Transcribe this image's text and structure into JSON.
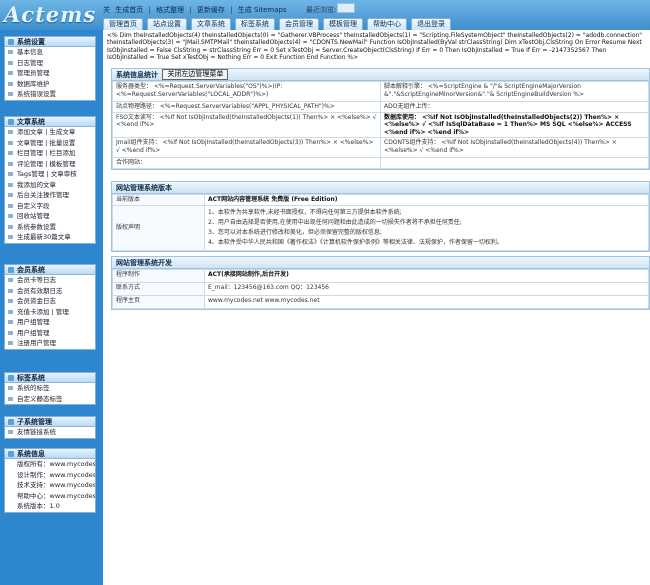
{
  "logo": "Actems",
  "toplinks": {
    "items": [
      "关",
      "生成首页",
      "|",
      "格式整理",
      "|",
      "更新缓存",
      "|",
      "生成 Sitemaps"
    ],
    "recent_label": "最近浏览:"
  },
  "tabs": [
    "管理首页",
    "站点设置",
    "文章系统",
    "标签系统",
    "会员管理",
    "模板管理",
    "帮助中心",
    "退出登录"
  ],
  "sidebar": {
    "groups": [
      {
        "title": "系统设置",
        "items": [
          "基本信息",
          "日志管理",
          "管理员管理",
          "数据库维护",
          "系统错误设置"
        ]
      },
      {
        "title": "文章系统",
        "items": [
          "添加文章 | 生成文章",
          "文章管理 | 批量设置",
          "栏目管理 | 栏目添加",
          "评论管理 | 模板管理",
          "Tags管理 | 文章审核",
          "我添加的文章",
          "后台关注操作管理",
          "自定义字段",
          "回收站管理",
          "系统参数设置",
          "生成最新30篇文章"
        ]
      },
      {
        "title": "会员系统",
        "items": [
          "会员卡等日志",
          "会员有效期日志",
          "会员资金日志",
          "充值卡添加 | 管理",
          "用户组管理",
          "用户组管理",
          "注册用户管理"
        ]
      },
      {
        "title": "标签系统",
        "items": [
          "系统的标签",
          "自定义静态标签"
        ]
      },
      {
        "title": "子系统管理",
        "items": [
          "友情链接系统"
        ]
      },
      {
        "title": "系统信息",
        "items": [
          "版权所有：www.mycodes.net",
          "设计制作：www.mycodes.net",
          "技术支持：www.mycodes.net",
          "帮助中心：www.mycodes.net",
          "系统版本：1.0"
        ]
      }
    ]
  },
  "debug_text": "<% Dim theInstalledObjects(4) theInstalledObjects(0) = \"Gatherer.VBProcess\" theInstalledObjects(1) = \"Scripting.FileSystemObject\" theInstalledObjects(2) = \"adodb.connection\" theInstalledObjects(3) = \"JMail.SMTPMail\" theInstalledObjects(4) = \"CDONTS.NewMail\" Function IsObjInstalled(ByVal strClassString) Dim xTestObj,ClsString On Error Resume Next IsObjInstalled = False ClsString = strClassString Err = 0 Set xTestObj = Server.CreateObject(ClsString) If Err = 0 Then IsObjInstalled = True If Err = -2147352567 Then IsObjInstalled = True Set xTestObj = Nothing Err = 0 Exit Function End Function %>",
  "sysinfo": {
    "title": "系统信息统计",
    "button": "关闭左边管理菜单",
    "rows": [
      [
        "服务器类型： <%=Request.ServerVariables(\"OS\")%>(IP:<%=Request.ServerVariables(\"LOCAL_ADDR\")%>)",
        "脚本解释引擎： <%=ScriptEngine & \"/\"& ScriptEngineMajorVersion &\".\"&ScriptEngineMinorVersion&\".\"& ScriptEngineBuildVersion %>"
      ],
      [
        "站点物理路径： <%=Request.ServerVariables(\"APPL_PHYSICAL_PATH\")%>",
        "ADO无组件上传："
      ],
      [
        "FSO文本读写： <%If Not IsObjInstalled(theInstalledObjects(1)) Then%> × <%else%> √ <%end if%>",
        "数据库使用： <%If Not IsObjInstalled(theInstalledObjects(2)) Then%> × <%else%> √ <%If IsSqlDataBase = 1 Then%> MS SQL <%else%> ACCESS <%end if%> <%end if%>"
      ],
      [
        "Jmail组件支持： <%If Not IsObjInstalled(theInstalledObjects(3)) Then%> × <%else%> √ <%end if%>",
        "CDONTS组件支持： <%If Not IsObjInstalled(theInstalledObjects(4)) Then%> × <%else%> √ <%end if%>"
      ],
      [
        "合作网站：",
        ""
      ]
    ]
  },
  "sitever": {
    "title": "网站管理系统版本",
    "version_label": "当前版本",
    "version_value": "ACT网站内容管理系统 免费版 (Free Edition)",
    "license_label": "版权声明",
    "license_lines": [
      "1、本软件为共享软件,未经书面授权，不得向任何第三方提供本软件系统;",
      "2、用户自由选择是否使用,在使用中出现任何问题和由此造成的一切损失作者将不承担任何责任;",
      "3、您可以对本系统进行修改和美化，但必须保留完整的版权信息;",
      "4、本软件受中华人民共和国《著作权法》《计算机软件保护条例》等相关法律、法规保护，作者保留一切权利。"
    ]
  },
  "sitedev": {
    "title": "网站管理系统开发",
    "rows": [
      [
        "程序制作",
        "ACT(承接网站制作,后台开发)"
      ],
      [
        "联系方式",
        "E_mail：123456@163.com QQ：123456"
      ],
      [
        "程序主页",
        "www.mycodes.net    www.mycodes.net"
      ]
    ]
  }
}
